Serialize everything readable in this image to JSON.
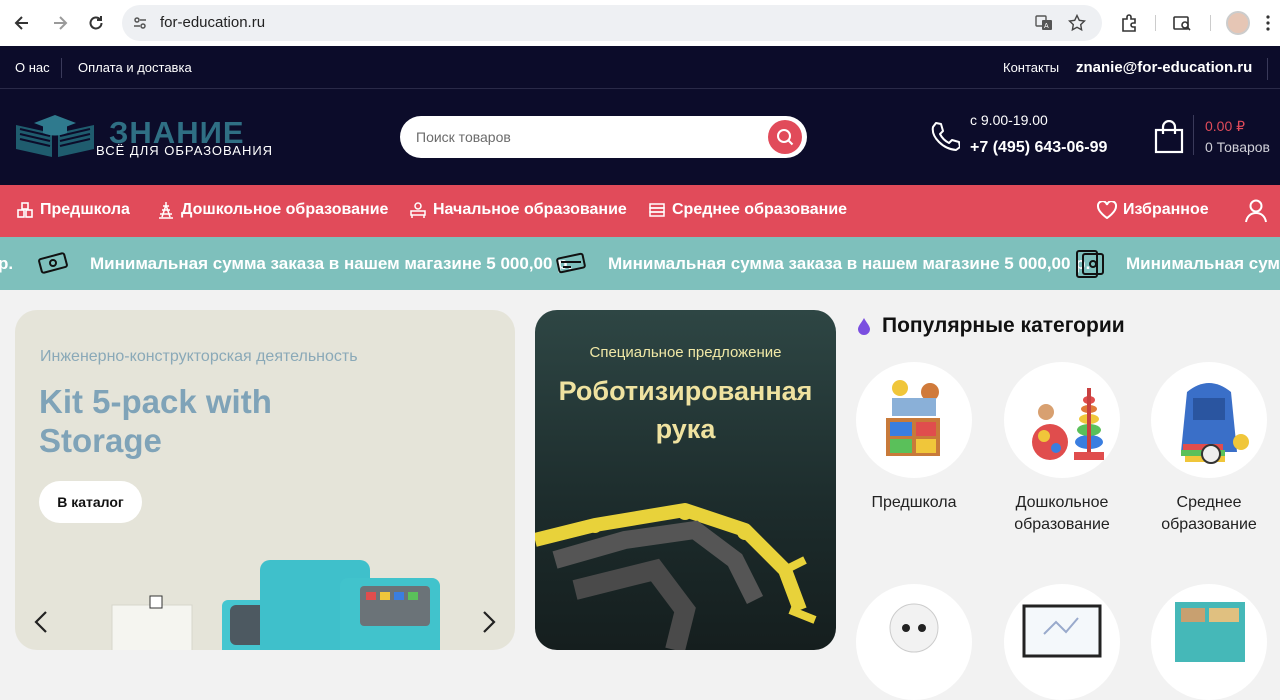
{
  "browser": {
    "url": "for-education.ru"
  },
  "topbar": {
    "about": "О нас",
    "delivery": "Оплата и доставка",
    "contacts": "Контакты",
    "email": "znanie@for-education.ru"
  },
  "header": {
    "logo_title": "ЗНАНИЕ",
    "logo_subtitle": "ВСЁ ДЛЯ ОБРАЗОВАНИЯ",
    "search_placeholder": "Поиск товаров",
    "hours": "с 9.00-19.00",
    "phone": "+7 (495) 643-06-99",
    "cart_sum": "0.00 ₽",
    "cart_count": "0 Товаров"
  },
  "menu": {
    "items": [
      {
        "label": "Предшкола",
        "icon": "blocks-icon"
      },
      {
        "label": "Дошкольное образование",
        "icon": "pyramid-icon"
      },
      {
        "label": "Начальное образование",
        "icon": "desk-icon"
      },
      {
        "label": "Среднее образование",
        "icon": "books-icon"
      }
    ],
    "favorites": "Избранное",
    "account_icon": "user-icon"
  },
  "ticker": {
    "fragment": "р.",
    "message": "Минимальная сумма заказа в нашем магазине 5 000,00 р.",
    "partial": "Минимальная сумма"
  },
  "banner1": {
    "caption": "Инженерно-конструкторская деятельность",
    "title": "Kit 5-pack with Storage",
    "button": "В каталог"
  },
  "banner2": {
    "caption": "Специальное предложение",
    "title": "Роботизированная рука"
  },
  "popular": {
    "heading": "Популярные категории",
    "items": [
      {
        "label": "Предшкола"
      },
      {
        "label": "Дошкольное образование"
      },
      {
        "label": "Среднее образование"
      }
    ]
  },
  "colors": {
    "dark": "#0c0c2a",
    "accent": "#e14b5a",
    "ticker": "#7ec0bc"
  }
}
